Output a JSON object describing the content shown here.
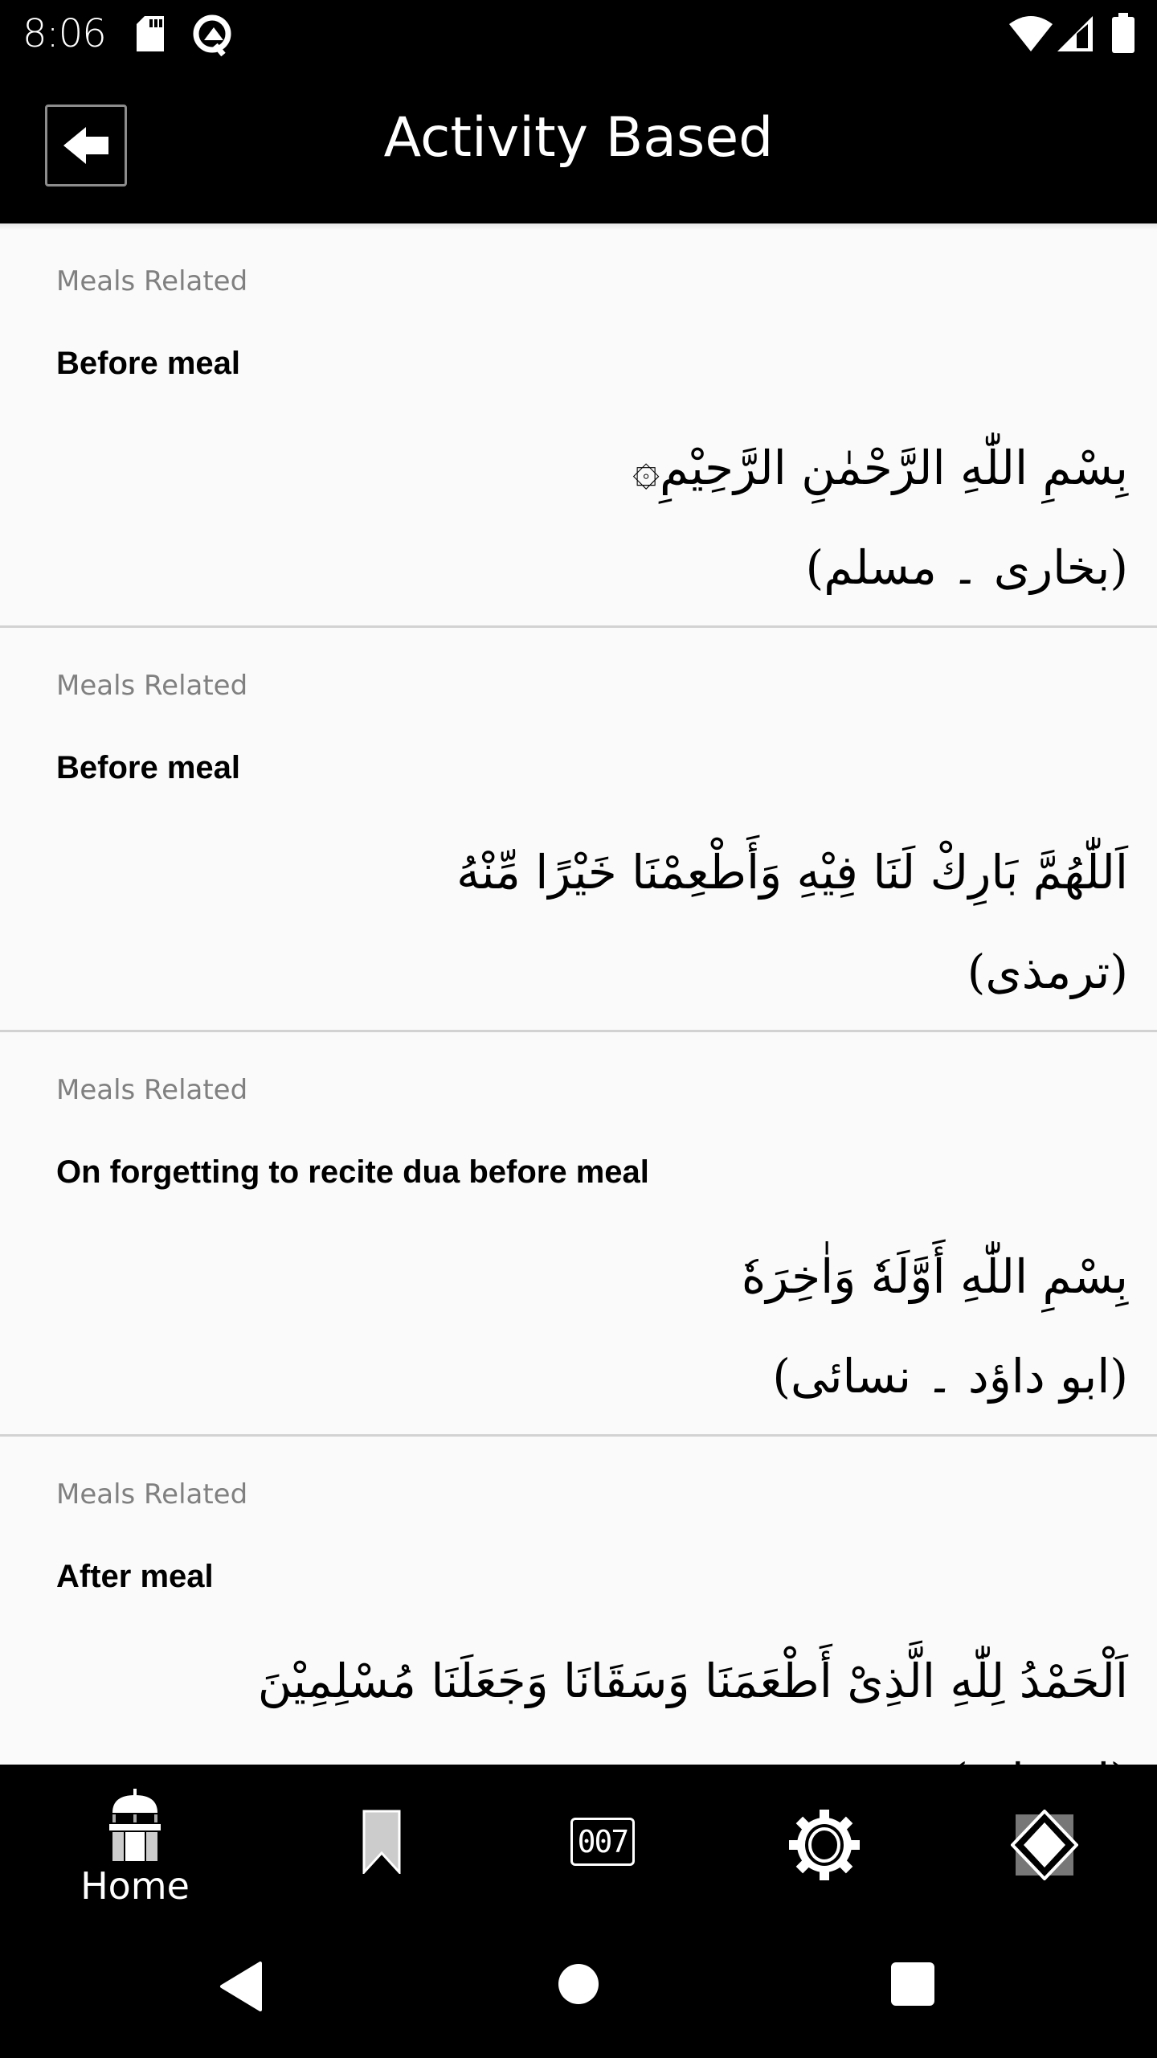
{
  "status_bar": {
    "time": "8:06",
    "left_icons": [
      "sd-card-icon",
      "q-logo-icon"
    ],
    "right_icons": [
      "wifi-icon",
      "cell-signal-icon",
      "battery-icon"
    ]
  },
  "toolbar": {
    "back_icon": "arrow-left-icon",
    "title": "Activity Based"
  },
  "duas": [
    {
      "category": "Meals Related",
      "title": "Before meal",
      "arabic": "بِسْمِ اللّٰهِ الرَّحْمٰنِ الرَّحِيْمِ۞",
      "reference": "(بخاری ۔ مسلم)"
    },
    {
      "category": "Meals Related",
      "title": "Before meal",
      "arabic": "اَللّٰهُمَّ بَارِكْ لَنَا فِيْهِ وَأَطْعِمْنَا خَيْرًا مِّنْهُ",
      "reference": "(ترمذی)"
    },
    {
      "category": "Meals Related",
      "title": "On forgetting to recite dua before meal",
      "arabic": "بِسْمِ اللّٰهِ أَوَّلَهٗ وَاٰخِرَهٗ",
      "reference": "(ابو داؤد ۔ نسائی)"
    },
    {
      "category": "Meals Related",
      "title": "After meal",
      "arabic": "اَلْحَمْدُ لِلّٰهِ الَّذِىْ أَطْعَمَنَا وَسَقَانَا وَجَعَلَنَا مُسْلِمِيْنَ",
      "reference": "(ابو داؤد)"
    }
  ],
  "bottom_nav": {
    "items": [
      {
        "icon": "mosque-home-icon",
        "label": "Home",
        "active": true
      },
      {
        "icon": "bookmark-icon",
        "label": ""
      },
      {
        "icon": "counter-icon",
        "label": "",
        "counter_text": "007"
      },
      {
        "icon": "gear-icon",
        "label": ""
      },
      {
        "icon": "diamond-icon",
        "label": ""
      }
    ]
  },
  "system_nav": {
    "items": [
      "back-triangle-icon",
      "home-circle-icon",
      "recents-square-icon"
    ]
  }
}
